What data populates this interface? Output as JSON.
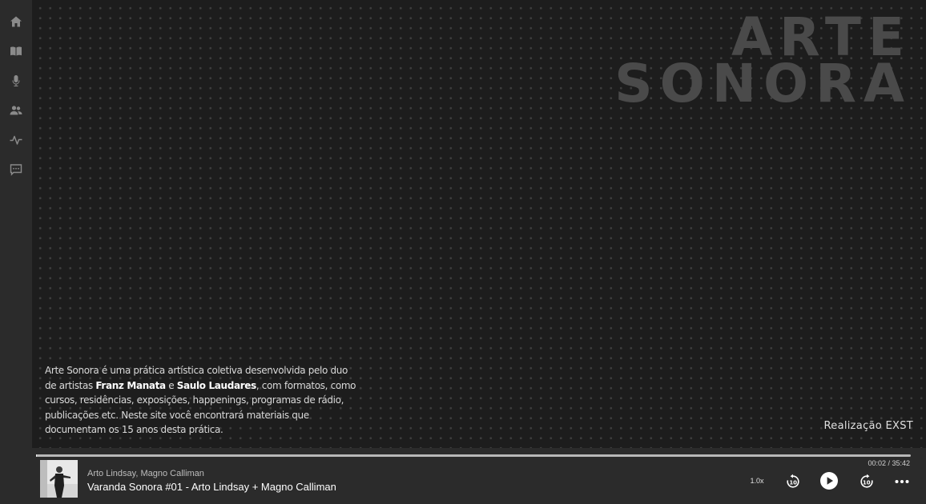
{
  "sidebar": {
    "items": [
      {
        "icon": "home-icon",
        "label": "Início"
      },
      {
        "icon": "book-icon",
        "label": "Publicações"
      },
      {
        "icon": "microphone-icon",
        "label": "Rádio"
      },
      {
        "icon": "people-icon",
        "label": "Artistas"
      },
      {
        "icon": "activity-icon",
        "label": "Atividades"
      },
      {
        "icon": "chat-icon",
        "label": "Contato"
      }
    ]
  },
  "hero": {
    "title_line1": "ARTE",
    "title_line2": "SONORA",
    "intro_part1": "Arte Sonora é uma prática artística coletiva desenvolvida pelo duo de artistas ",
    "artist1": "Franz Manata",
    "intro_part2": " e ",
    "artist2": "Saulo Laudares",
    "intro_part3": ", com formatos, como cursos, residências, exposições, happenings, programas de rádio, publicações etc. Neste site você encontrará materiais que documentam os 15 anos desta prática.",
    "credit": "Realização EXST"
  },
  "player": {
    "artists": "Arto Lindsay, Magno Calliman",
    "track_title": "Varanda Sonora #01 - Arto Lindsay + Magno Calliman",
    "time": "00:02 / 35:42",
    "progress": 0.001,
    "speed": "1.0x"
  },
  "colors": {
    "background": "#1d1d1d",
    "sidebar": "#2b2b2b",
    "dots": "#3d3d3d",
    "title": "#4a4a4a"
  }
}
